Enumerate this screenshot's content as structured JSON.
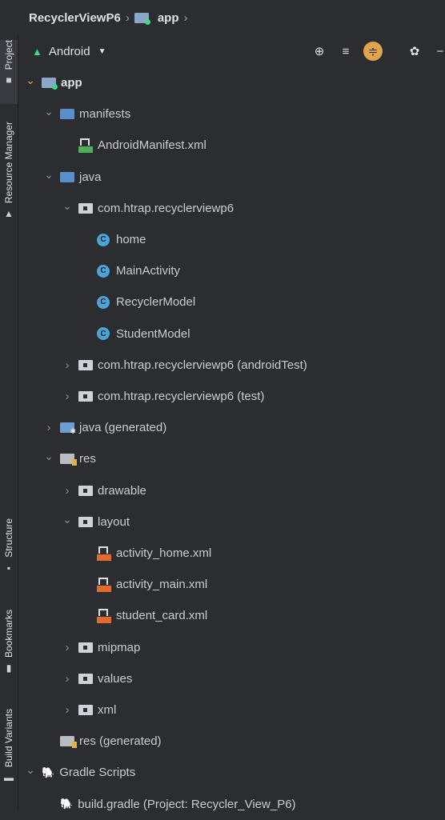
{
  "breadcrumb": {
    "project": "RecyclerViewP6",
    "module": "app",
    "sep1": "›",
    "sep2": "›"
  },
  "toolwindows": {
    "project": "Project",
    "resource_manager": "Resource Manager",
    "structure": "Structure",
    "bookmarks": "Bookmarks",
    "build_variants": "Build Variants"
  },
  "panel": {
    "view_mode": "Android",
    "accent": "#e0a54a",
    "android_color": "#3ddc84"
  },
  "tree": [
    {
      "label": "app",
      "depth": 0,
      "chevron": "down",
      "icon": "module-folder",
      "bold": true
    },
    {
      "label": "manifests",
      "depth": 1,
      "chevron": "down",
      "icon": "folder"
    },
    {
      "label": "AndroidManifest.xml",
      "depth": 2,
      "chevron": "",
      "icon": "manifest-file"
    },
    {
      "label": "java",
      "depth": 1,
      "chevron": "down",
      "icon": "folder"
    },
    {
      "label": "com.htrap.recyclerviewp6",
      "depth": 2,
      "chevron": "down",
      "icon": "package"
    },
    {
      "label": "home",
      "depth": 3,
      "chevron": "",
      "icon": "class"
    },
    {
      "label": "MainActivity",
      "depth": 3,
      "chevron": "",
      "icon": "class"
    },
    {
      "label": "RecyclerModel",
      "depth": 3,
      "chevron": "",
      "icon": "class"
    },
    {
      "label": "StudentModel",
      "depth": 3,
      "chevron": "",
      "icon": "class"
    },
    {
      "label": "com.htrap.recyclerviewp6 (androidTest)",
      "depth": 2,
      "chevron": "right",
      "icon": "package"
    },
    {
      "label": "com.htrap.recyclerviewp6 (test)",
      "depth": 2,
      "chevron": "right",
      "icon": "package"
    },
    {
      "label": "java (generated)",
      "depth": 1,
      "chevron": "right",
      "icon": "generated-folder"
    },
    {
      "label": "res",
      "depth": 1,
      "chevron": "down",
      "icon": "res-folder"
    },
    {
      "label": "drawable",
      "depth": 2,
      "chevron": "right",
      "icon": "package"
    },
    {
      "label": "layout",
      "depth": 2,
      "chevron": "down",
      "icon": "package"
    },
    {
      "label": "activity_home.xml",
      "depth": 3,
      "chevron": "",
      "icon": "layout-file"
    },
    {
      "label": "activity_main.xml",
      "depth": 3,
      "chevron": "",
      "icon": "layout-file"
    },
    {
      "label": "student_card.xml",
      "depth": 3,
      "chevron": "",
      "icon": "layout-file"
    },
    {
      "label": "mipmap",
      "depth": 2,
      "chevron": "right",
      "icon": "package"
    },
    {
      "label": "values",
      "depth": 2,
      "chevron": "right",
      "icon": "package"
    },
    {
      "label": "xml",
      "depth": 2,
      "chevron": "right",
      "icon": "package"
    },
    {
      "label": "res (generated)",
      "depth": 1,
      "chevron": "",
      "icon": "res-folder"
    },
    {
      "label": "Gradle Scripts",
      "depth": 0,
      "chevron": "down",
      "icon": "gradle"
    },
    {
      "label": "build.gradle (Project: Recycler_View_P6)",
      "depth": 1,
      "chevron": "",
      "icon": "gradle"
    }
  ]
}
